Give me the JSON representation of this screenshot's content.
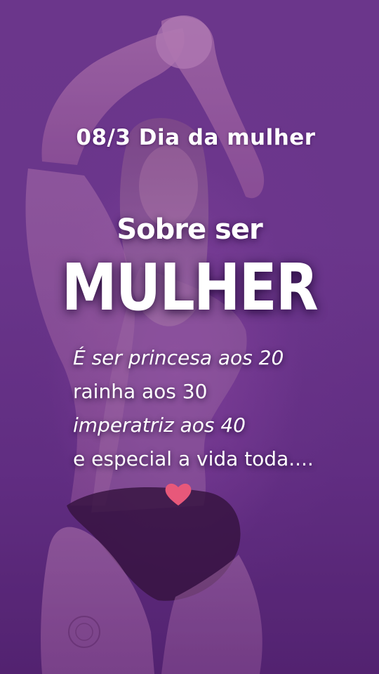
{
  "post": {
    "subtitle": "08/3 Dia da mulher",
    "headline_small": "Sobre ser",
    "headline_big": "MULHER",
    "lines": [
      "É ser princesa aos 20",
      "rainha aos 30",
      "imperatriz aos 40",
      "e especial a vida toda...."
    ],
    "heart_icon": "heart-icon",
    "heart_color": "#e8587a"
  },
  "colors": {
    "background": "#6a3a8c",
    "text": "#ffffff"
  }
}
